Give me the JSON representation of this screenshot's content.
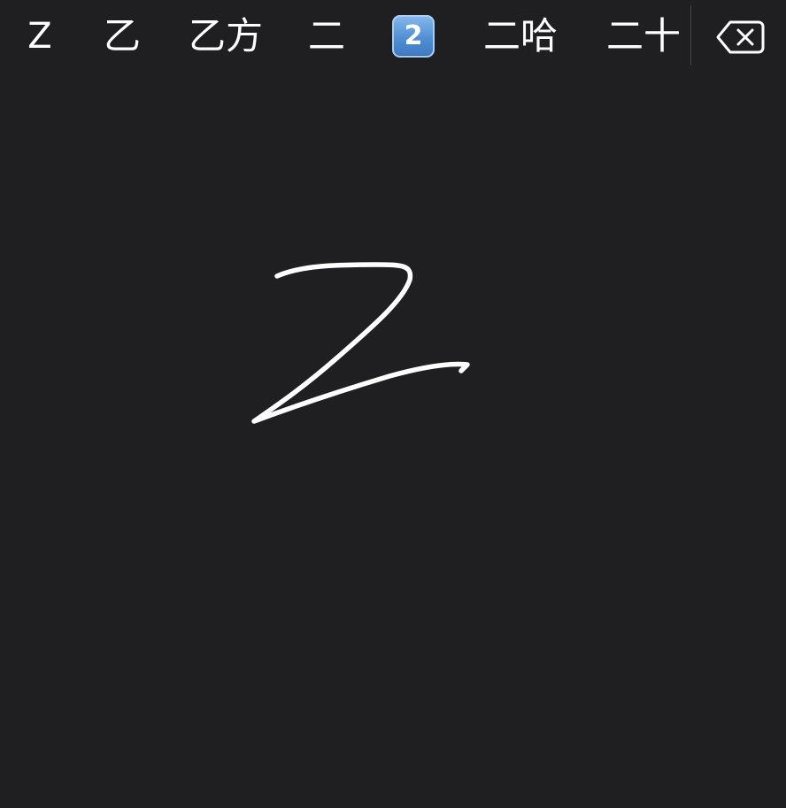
{
  "candidate_bar": {
    "candidates": [
      {
        "label": "Z"
      },
      {
        "label": "乙"
      },
      {
        "label": "乙方"
      },
      {
        "label": "二"
      },
      {
        "label": "2",
        "kind": "keycap-emoji",
        "color": "#4f8fd4"
      },
      {
        "label": "二哈"
      },
      {
        "label": "二十"
      }
    ],
    "delete_icon": "delete-backspace-icon"
  },
  "handwriting": {
    "stroke_color": "#ffffff",
    "background": "#1f1e21",
    "recognized_shape": "Z"
  }
}
